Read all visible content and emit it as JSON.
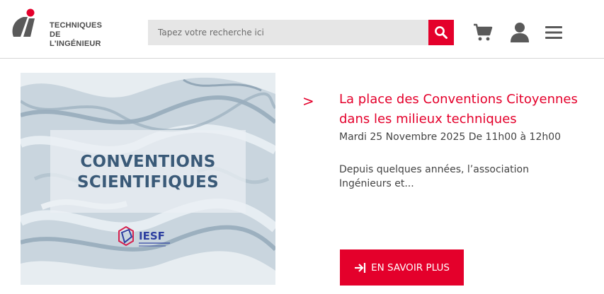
{
  "header": {
    "logo": {
      "line1": "TECHNIQUES",
      "line2": "DE L'INGÉNIEUR"
    },
    "search": {
      "placeholder": "Tapez votre recherche ici",
      "value": ""
    },
    "icons": [
      "search-icon",
      "cart-icon",
      "user-icon",
      "menu-icon"
    ]
  },
  "event": {
    "image": {
      "heading": "CONVENTIONS SCIENTIFIQUES",
      "badge": "IESF"
    },
    "title": "La place des Conventions Citoyennes dans les milieux techniques",
    "date": "Mardi 25 Novembre 2025 De 11h00 à 12h00",
    "excerpt": "Depuis quelques années, l’association Ingénieurs et...",
    "cta_label": "EN SAVOIR PLUS"
  },
  "colors": {
    "accent": "#e4002b",
    "icon_gray": "#5a5a5a",
    "search_bg": "#e6e6e6"
  }
}
